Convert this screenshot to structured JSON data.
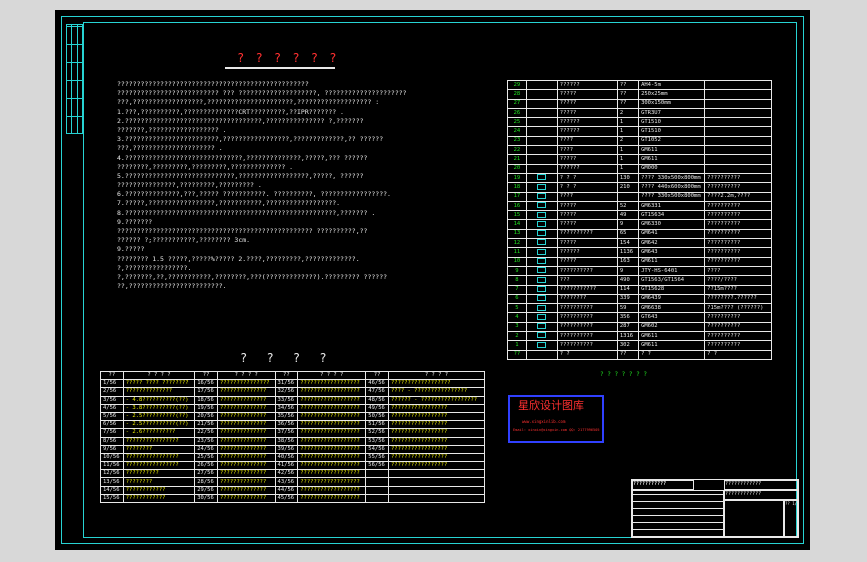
{
  "colors": {
    "frame": "#27d3d3",
    "text": "#e8e8e8",
    "yellow": "#e6e600",
    "green": "#20e020",
    "red": "#ff3030",
    "stamp": "#3040ff"
  },
  "doc": {
    "title": "? ? ? ? ? ?",
    "paras": [
      "?????????????????????????????????????????????????",
      "  ??????????????????????????     ???      ????????????????????,   ?????????????????????",
      "???,??????????????????,??????????????????????,??????????????????? :",
      "  1.???,??????????,??????????????CRT?????????,??IPR??????? .",
      "  2.???????????????????????????????????,???????????????           ?,???????",
      "???????,?????????????????? .",
      "  3.????????????????????????,?????????????????,?????????????,??              ??????",
      "???,????????????????????? .",
      "  4.??????????????????????????????,??????????????,?????,???               ??????",
      "????????,?????????,?????????,?????????????? .",
      "  5.????????????????????????????,??????????????????,?????,               ??????",
      "???????????????,?????????,????????? .",
      "  6.??????????????,???,?????      ???????????. ??????????,  ?????????????????.",
      "  7.?????,?????????????????,???????????,??????????????????.",
      "  8.??????????????????????????????????????????????????????,???????  .",
      "  9.???????",
      "    ??????????????????????????????????????????????????           ??????????,??",
      "??????     ?;???????????,????????      3cm.",
      "  9.?????",
      "    ????????   1.5 ?????,?????%?????     2.????,?????????,?????????????.",
      "  ?,????????????????.",
      "  ?,???????,??,???????????,????????,???(?????????????).?????????            ??????",
      "??,????????????????????????."
    ],
    "legend_heading": "? ? ? ?",
    "legend_headers": [
      "??",
      "? ? ? ?",
      "??",
      "? ? ? ?",
      "??",
      "? ? ? ?",
      "??",
      "? ? ? ?"
    ],
    "legend_rows": [
      [
        "1/56",
        "????? ???? ????????",
        "16/56",
        "???????????????",
        "31/56",
        "??????????????????",
        "46/56",
        "??????????????????"
      ],
      [
        "2/56",
        "??????????????",
        "17/56",
        "??????????????",
        "32/56",
        "??????????????????",
        "47/56",
        "???? - ????????????????"
      ],
      [
        "3/56",
        "- 4.8??????????(??)",
        "18/56",
        "??????????????",
        "33/56",
        "??????????????????",
        "48/56",
        "?????? - ?????????????????"
      ],
      [
        "4/56",
        "- 3.8??????????(??)",
        "19/56",
        "??????????????",
        "34/56",
        "??????????????????",
        "49/56",
        "?????????????????"
      ],
      [
        "5/56",
        "- 2.5??????????(??)",
        "20/56",
        "??????????????",
        "35/56",
        "??????????????????",
        "50/56",
        "?????????????????"
      ],
      [
        "6/56",
        "- 2.5??????????(??)",
        "21/56",
        "??????????????",
        "36/56",
        "??????????????????",
        "51/56",
        "?????????????????"
      ],
      [
        "7/56",
        "- 2.6??????????",
        "22/56",
        "??????????????",
        "37/56",
        "??????????????????",
        "52/56",
        "?????????????????"
      ],
      [
        "8/56",
        "????????????????",
        "23/56",
        "??????????????",
        "38/56",
        "??????????????????",
        "53/56",
        "?????????????????"
      ],
      [
        "9/56",
        "????????",
        "24/56",
        "??????????????",
        "39/56",
        "??????????????????",
        "54/56",
        "?????????????????"
      ],
      [
        "10/56",
        "????????????????",
        "25/56",
        "??????????????",
        "40/56",
        "??????????????????",
        "55/56",
        "?????????????????"
      ],
      [
        "11/56",
        "????????????????",
        "26/56",
        "??????????????",
        "41/56",
        "??????????????????",
        "56/56",
        "?????????????????"
      ],
      [
        "12/56",
        "??????????",
        "27/56",
        "??????????????",
        "42/56",
        "??????????????????",
        "",
        ""
      ],
      [
        "13/56",
        "????????",
        "28/56",
        "??????????????",
        "43/56",
        "??????????????????",
        "",
        ""
      ],
      [
        "14/56",
        "????????????",
        "29/56",
        "??????????????",
        "44/56",
        "??????????????????",
        "",
        ""
      ],
      [
        "15/56",
        "????????????",
        "30/56",
        "??????????????",
        "45/56",
        "??????????????????",
        "",
        ""
      ]
    ],
    "equip_rows": [
      [
        "29",
        "",
        "??????",
        "??",
        "AH4-5m"
      ],
      [
        "28",
        "",
        "?????",
        "??",
        "250x25mm"
      ],
      [
        "27",
        "",
        "?????",
        "??",
        "300x150mm"
      ],
      [
        "26",
        "",
        "?????",
        "2",
        "GTR3U7"
      ],
      [
        "25",
        "",
        "??????",
        "1",
        "GT1510"
      ],
      [
        "24",
        "",
        "??????",
        "1",
        "GT1510"
      ],
      [
        "23",
        "",
        "????",
        "2",
        "GT1052"
      ],
      [
        "22",
        "",
        "????",
        "1",
        "GM611"
      ],
      [
        "21",
        "",
        "?????",
        "1",
        "GM611"
      ],
      [
        "20",
        "",
        "??????",
        "1",
        "GM000"
      ],
      [
        "19",
        "",
        "? ? ?",
        "130",
        "???? 330x500x800mm",
        "??????????"
      ],
      [
        "18",
        "",
        "? ? ?",
        "210",
        "???? 440x600x800mm",
        "??????????"
      ],
      [
        "17",
        "",
        "????",
        "",
        "???? 330x500x800mm",
        "????2.2m,????"
      ],
      [
        "16",
        "",
        "?????",
        "52",
        "GM6331",
        "??????????"
      ],
      [
        "15",
        "",
        "?????",
        "49",
        "GT15634",
        "??????????"
      ],
      [
        "14",
        "",
        "?????",
        "9",
        "GM6330",
        "??????????"
      ],
      [
        "13",
        "",
        "??????????",
        "65",
        "GM641",
        "??????????"
      ],
      [
        "12",
        "",
        "?????",
        "154",
        "GM642",
        "??????????"
      ],
      [
        "11",
        "",
        "??????",
        "1136",
        "GM643",
        "??????????"
      ],
      [
        "10",
        "",
        "?????",
        "163",
        "GM611",
        "??????????"
      ],
      [
        "9",
        "",
        "??????????",
        "9",
        "JTY-HS-6401",
        "????"
      ],
      [
        "8",
        "",
        "???",
        "490",
        "GT1563/GT1564",
        "????/????"
      ],
      [
        "7",
        "",
        "???????????",
        "114",
        "GT15628",
        "??15m????"
      ],
      [
        "6",
        "",
        "????????",
        "339",
        "GM6439",
        "????????.??????"
      ],
      [
        "5",
        "",
        "??????????",
        "59",
        "GM6638",
        "?15m???? (??????)"
      ],
      [
        "4",
        "",
        "??????????",
        "356",
        "GT643",
        "??????????"
      ],
      [
        "3",
        "",
        "??????????",
        "287",
        "GM602",
        "??????????"
      ],
      [
        "2",
        "",
        "??????????",
        "1316",
        "GM611",
        "??????????"
      ],
      [
        "1",
        "",
        "??????????",
        "302",
        "GM611",
        "??????????"
      ],
      [
        "??",
        "?",
        "? ?",
        "??",
        "? ?",
        "? ?"
      ]
    ],
    "equip_footer": "? ? ? ? ? ? ?",
    "stamp": {
      "line1": "星欣设计图库",
      "line2": "www.xingxinlib.com",
      "line3": "Email: xinxin@xingxin.com  QQ: 2177996505"
    },
    "title_block": {
      "company": "???????????",
      "project": "????????????",
      "drawing": "????????????",
      "num": "?? 1/56"
    }
  }
}
